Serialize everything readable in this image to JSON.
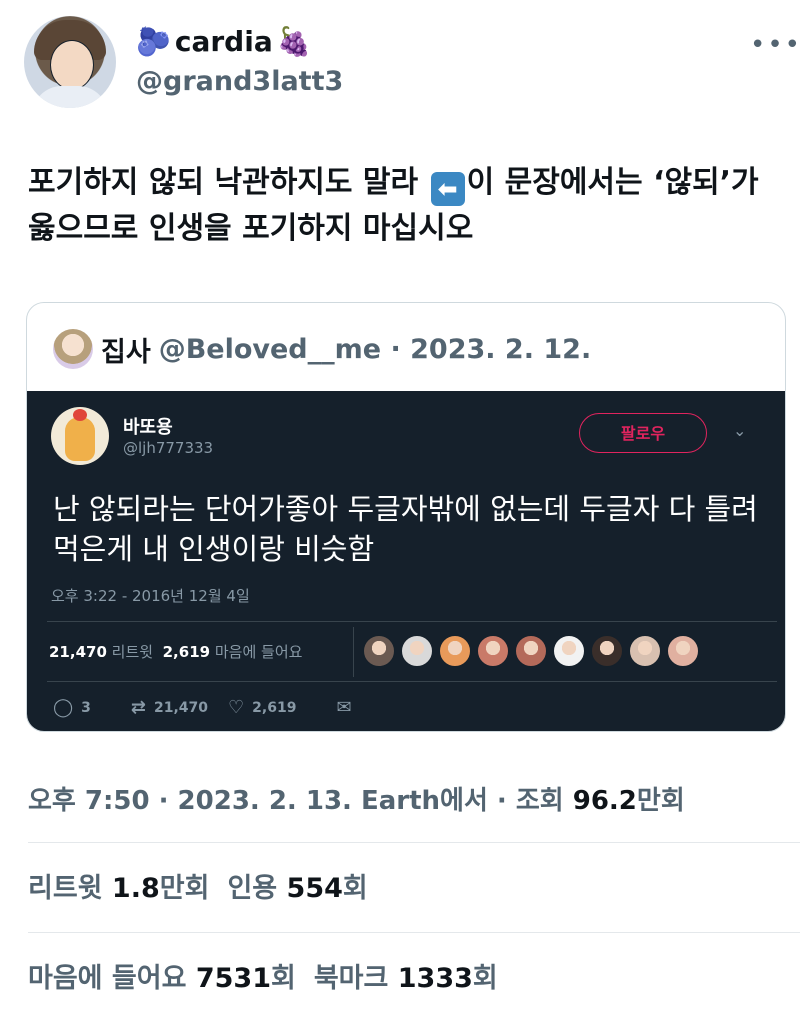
{
  "author": {
    "emoji_left": "🫐",
    "display_name": "cardia",
    "emoji_right": "🍇",
    "handle": "@grand3latt3"
  },
  "tweet": {
    "text_before_icon": "포기하지 않되 낙관하지도 말라 ",
    "icon": "left-arrow-icon",
    "text_after_icon": "이 문장에서는 ‘않되’가 옳으므로 인생을 포기하지 마십시오"
  },
  "quote": {
    "name": "집사",
    "handle_date": "@Beloved__me · 2023. 2. 12.",
    "embedded": {
      "name": "바또용",
      "handle": "@ljh777333",
      "follow_label": "팔로우",
      "text": "난 않되라는 단어가좋아 두글자밖에 없는데 두글자 다 틀려먹은게 내 인생이랑 비슷함",
      "timestamp": "오후 3:22 - 2016년 12월 4일",
      "retweet_count": "21,470",
      "retweet_label": "리트윗",
      "like_count": "2,619",
      "like_label": "마음에 들어요",
      "reply_action_count": "3",
      "retweet_action_count": "21,470",
      "like_action_count": "2,619",
      "face_colors": [
        "#6b5a52",
        "#d9d9d9",
        "#e89a5a",
        "#c97a68",
        "#b46a5a",
        "#f2f2f2",
        "#3a2e2a",
        "#d8c0b0",
        "#e0b0a0"
      ]
    }
  },
  "footer": {
    "time_prefix": "오후 7:50 · 2023. 2. 13. Earth에서 · 조회 ",
    "views": "96.2",
    "views_unit": "만회",
    "retweets_label": "리트윗 ",
    "retweets_value": "1.8",
    "retweets_unit": "만회",
    "quotes_label": "인용 ",
    "quotes_value": "554",
    "quotes_unit": "회",
    "likes_label": "마음에 들어요 ",
    "likes_value": "7531",
    "likes_unit": "회",
    "bookmarks_label": "북마크 ",
    "bookmarks_value": "1333",
    "bookmarks_unit": "회"
  },
  "colors": {
    "primary_text": "#0f1419",
    "secondary_text": "#536471",
    "dark_card": "#15202b",
    "follow_accent": "#e0245e"
  }
}
